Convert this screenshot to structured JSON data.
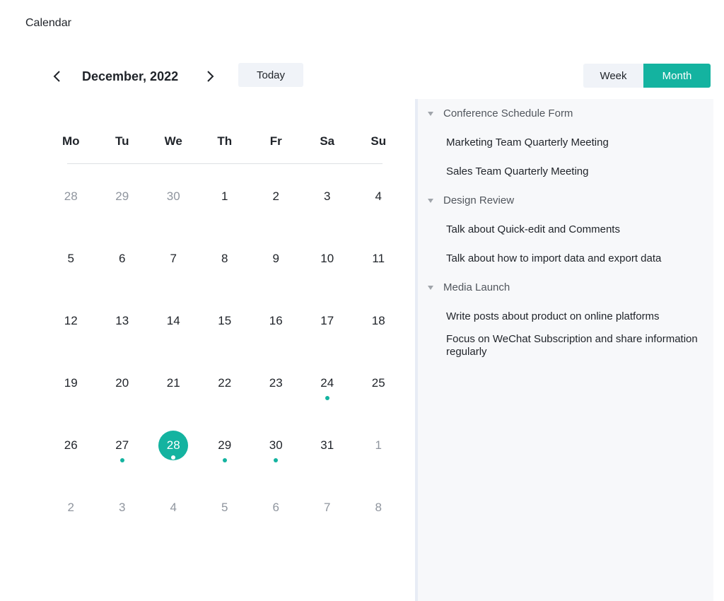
{
  "app": {
    "title": "Calendar"
  },
  "toolbar": {
    "month_label": "December, 2022",
    "today_label": "Today",
    "views": {
      "week": "Week",
      "month": "Month"
    },
    "active_view": "Month"
  },
  "colors": {
    "accent": "#14b3a0",
    "muted_text": "#8f959e",
    "panel_bg": "#f7f8fa"
  },
  "calendar": {
    "weekdays": [
      "Mo",
      "Tu",
      "We",
      "Th",
      "Fr",
      "Sa",
      "Su"
    ],
    "weeks": [
      [
        {
          "d": "28",
          "o": true
        },
        {
          "d": "29",
          "o": true
        },
        {
          "d": "30",
          "o": true
        },
        {
          "d": "1"
        },
        {
          "d": "2"
        },
        {
          "d": "3"
        },
        {
          "d": "4"
        }
      ],
      [
        {
          "d": "5"
        },
        {
          "d": "6"
        },
        {
          "d": "7"
        },
        {
          "d": "8"
        },
        {
          "d": "9"
        },
        {
          "d": "10"
        },
        {
          "d": "11"
        }
      ],
      [
        {
          "d": "12"
        },
        {
          "d": "13"
        },
        {
          "d": "14"
        },
        {
          "d": "15"
        },
        {
          "d": "16"
        },
        {
          "d": "17"
        },
        {
          "d": "18"
        }
      ],
      [
        {
          "d": "19"
        },
        {
          "d": "20"
        },
        {
          "d": "21"
        },
        {
          "d": "22"
        },
        {
          "d": "23"
        },
        {
          "d": "24",
          "e": true
        },
        {
          "d": "25"
        }
      ],
      [
        {
          "d": "26"
        },
        {
          "d": "27",
          "e": true
        },
        {
          "d": "28",
          "e": true,
          "s": true
        },
        {
          "d": "29",
          "e": true
        },
        {
          "d": "30",
          "e": true
        },
        {
          "d": "31"
        },
        {
          "d": "1",
          "o": true
        }
      ],
      [
        {
          "d": "2",
          "o": true
        },
        {
          "d": "3",
          "o": true
        },
        {
          "d": "4",
          "o": true
        },
        {
          "d": "5",
          "o": true
        },
        {
          "d": "6",
          "o": true
        },
        {
          "d": "7",
          "o": true
        },
        {
          "d": "8",
          "o": true
        }
      ]
    ]
  },
  "panel": {
    "groups": [
      {
        "title": "Conference Schedule Form",
        "items": [
          "Marketing Team Quarterly Meeting",
          "Sales Team Quarterly Meeting"
        ]
      },
      {
        "title": "Design Review",
        "items": [
          "Talk about Quick-edit and Comments",
          "Talk about how to import data and export data"
        ]
      },
      {
        "title": "Media Launch",
        "items": [
          "Write posts about product on online platforms",
          "Focus on WeChat Subscription and share information regularly"
        ]
      }
    ]
  }
}
